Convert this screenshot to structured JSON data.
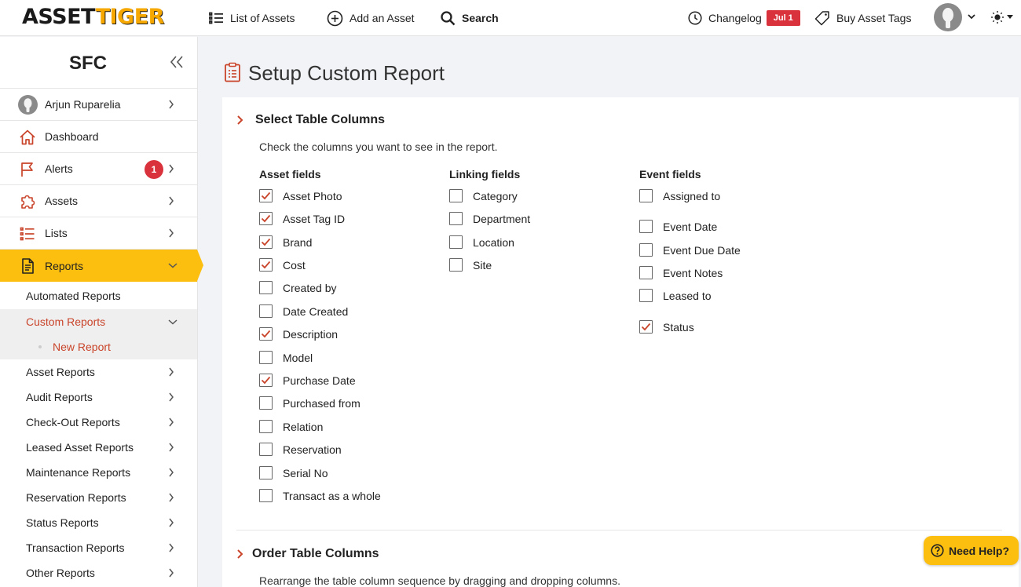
{
  "topbar": {
    "logo_part1": "ASSET",
    "logo_part2": "TIGER",
    "nav": {
      "list_assets": "List of Assets",
      "add_asset": "Add an Asset",
      "search": "Search",
      "changelog": "Changelog",
      "changelog_badge": "Jul 1",
      "buy_tags": "Buy Asset Tags"
    },
    "icons": [
      "list-icon",
      "plus-circle-icon",
      "search-icon",
      "clock-icon",
      "tag-icon",
      "avatar",
      "chevron-down-icon",
      "sun-icon"
    ]
  },
  "sidebar": {
    "title": "SFC",
    "items": [
      {
        "label": "Arjun Ruparelia",
        "icon": "user-avatar"
      },
      {
        "label": "Dashboard",
        "icon": "home-icon"
      },
      {
        "label": "Alerts",
        "icon": "flag-icon",
        "badge": "1"
      },
      {
        "label": "Assets",
        "icon": "puzzle-icon"
      },
      {
        "label": "Lists",
        "icon": "list-icon"
      },
      {
        "label": "Reports",
        "icon": "report-icon"
      }
    ],
    "reports_sub": [
      "Automated Reports",
      "Custom Reports",
      "New Report",
      "Asset Reports",
      "Audit Reports",
      "Check-Out Reports",
      "Leased Asset Reports",
      "Maintenance Reports",
      "Reservation Reports",
      "Status Reports",
      "Transaction Reports",
      "Other Reports"
    ]
  },
  "main": {
    "page_title": "Setup Custom Report",
    "section1_title": "Select Table Columns",
    "section1_hint": "Check the columns you want to see in the report.",
    "columns": {
      "asset": {
        "heading": "Asset fields",
        "fields": [
          {
            "label": "Asset Photo",
            "checked": true
          },
          {
            "label": "Asset Tag ID",
            "checked": true
          },
          {
            "label": "Brand",
            "checked": true
          },
          {
            "label": "Cost",
            "checked": true
          },
          {
            "label": "Created by",
            "checked": false
          },
          {
            "label": "Date Created",
            "checked": false
          },
          {
            "label": "Description",
            "checked": true
          },
          {
            "label": "Model",
            "checked": false
          },
          {
            "label": "Purchase Date",
            "checked": true
          },
          {
            "label": "Purchased from",
            "checked": false
          },
          {
            "label": "Relation",
            "checked": false
          },
          {
            "label": "Reservation",
            "checked": false
          },
          {
            "label": "Serial No",
            "checked": false
          },
          {
            "label": "Transact as a whole",
            "checked": false
          }
        ]
      },
      "linking": {
        "heading": "Linking fields",
        "fields": [
          {
            "label": "Category",
            "checked": false
          },
          {
            "label": "Department",
            "checked": false
          },
          {
            "label": "Location",
            "checked": false
          },
          {
            "label": "Site",
            "checked": false
          }
        ]
      },
      "event": {
        "heading": "Event fields",
        "fields": [
          {
            "label": "Assigned to",
            "checked": false
          },
          {
            "label": "Event Date",
            "checked": false
          },
          {
            "label": "Event Due Date",
            "checked": false
          },
          {
            "label": "Event Notes",
            "checked": false
          },
          {
            "label": "Leased to",
            "checked": false
          },
          {
            "label": "Status",
            "checked": true
          }
        ]
      }
    },
    "section2_title": "Order Table Columns",
    "section2_hint": "Rearrange the table column sequence by dragging and dropping columns.",
    "help_label": "Need Help?"
  },
  "colors": {
    "accent": "#fdbf0f",
    "link_red": "#c9442a",
    "badge_red": "#d9323c"
  }
}
